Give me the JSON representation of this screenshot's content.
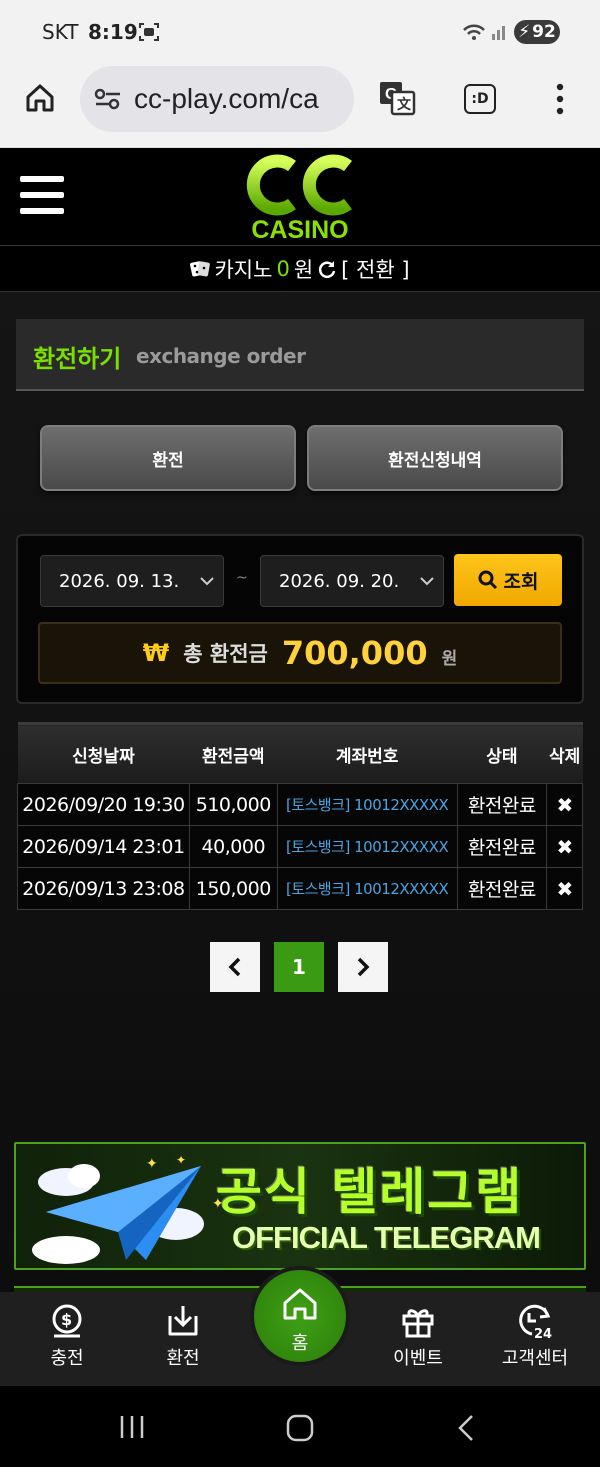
{
  "status_bar": {
    "carrier": "SKT",
    "time": "8:19",
    "battery": "92"
  },
  "browser": {
    "url": "cc-play.com/ca",
    "ext_label": ":D"
  },
  "header": {
    "logo_text": "CASINO"
  },
  "balance": {
    "label": "카지노",
    "amount": "0",
    "unit": "원",
    "switch_label": "[ 전환 ]"
  },
  "page_title": {
    "ko": "환전하기",
    "en": "exchange order"
  },
  "tabs": [
    {
      "label": "환전"
    },
    {
      "label": "환전신청내역"
    }
  ],
  "filter": {
    "start_date": "2026. 09. 13.",
    "end_date": "2026. 09. 20.",
    "separator": "~",
    "search_label": "조회"
  },
  "total": {
    "currency_symbol": "₩",
    "label": "총 환전금",
    "amount": "700,000",
    "unit": "원"
  },
  "table": {
    "headers": [
      "신청날짜",
      "환전금액",
      "계좌번호",
      "상태",
      "삭제"
    ],
    "rows": [
      {
        "date": "2026/09/20 19:30",
        "amount": "510,000",
        "account": "[토스뱅크] 10012XXXXX",
        "status": "환전완료",
        "delete": "✖"
      },
      {
        "date": "2026/09/14 23:01",
        "amount": "40,000",
        "account": "[토스뱅크] 10012XXXXX",
        "status": "환전완료",
        "delete": "✖"
      },
      {
        "date": "2026/09/13 23:08",
        "amount": "150,000",
        "account": "[토스뱅크] 10012XXXXX",
        "status": "환전완료",
        "delete": "✖"
      }
    ]
  },
  "pagination": {
    "prev": "‹",
    "current": "1",
    "next": "›"
  },
  "banner": {
    "title": "공식 텔레그램",
    "subtitle": "OFFICIAL TELEGRAM"
  },
  "bottom_nav": [
    {
      "label": "충전"
    },
    {
      "label": "환전"
    },
    {
      "label": "홈"
    },
    {
      "label": "이벤트"
    },
    {
      "label": "고객센터"
    }
  ],
  "colors": {
    "accent_green": "#7be000",
    "gold": "#ffc51a",
    "link_blue": "#4aa3e0"
  }
}
